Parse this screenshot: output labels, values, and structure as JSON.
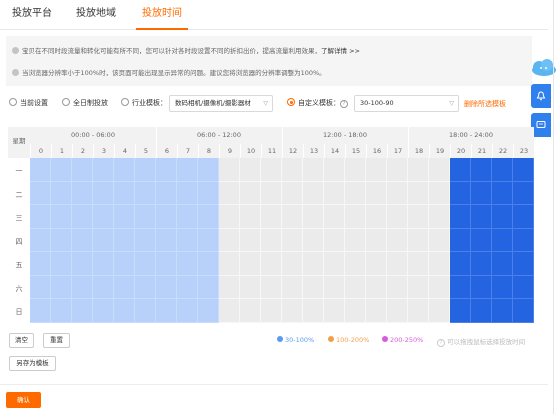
{
  "tabs": [
    {
      "label": "投放平台",
      "active": false
    },
    {
      "label": "投放地域",
      "active": false
    },
    {
      "label": "投放时间",
      "active": true
    }
  ],
  "notice": {
    "line1": "宝贝在不同时段流量和转化可能有所不同，您可以针对各时段设置不同的折扣出价，提高流量利用效果，",
    "line1_link": "了解详情 >>",
    "line2": "当浏览器分辨率小于100%时，该页面可能出现显示异常的问题。建议您将浏览器的分辨率调整为100%。"
  },
  "options": {
    "current": "当前设置",
    "all_day": "全日制投放",
    "industry_label": "行业模板：",
    "industry_select": "数码相机/摄像机/摄影器材",
    "custom_label": "自定义模板：",
    "custom_select": "30-100-90",
    "delete_link": "删除所选模板",
    "selected": "custom"
  },
  "grid": {
    "week_label": "星期",
    "periods": [
      "00:00 - 06:00",
      "06:00 - 12:00",
      "12:00 - 18:00",
      "18:00 - 24:00"
    ],
    "hours": [
      "0",
      "1",
      "2",
      "3",
      "4",
      "5",
      "6",
      "7",
      "8",
      "9",
      "10",
      "11",
      "12",
      "13",
      "14",
      "15",
      "16",
      "17",
      "18",
      "19",
      "20",
      "21",
      "22",
      "23"
    ],
    "days": [
      "一",
      "二",
      "三",
      "四",
      "五",
      "六",
      "日"
    ],
    "hour_levels": [
      "light",
      "light",
      "light",
      "light",
      "light",
      "light",
      "light",
      "light",
      "light",
      "none",
      "none",
      "none",
      "none",
      "none",
      "none",
      "none",
      "none",
      "none",
      "none",
      "none",
      "dark",
      "dark",
      "dark",
      "dark"
    ]
  },
  "buttons": {
    "clear": "清空",
    "reset": "重置",
    "save_template": "另存为模板",
    "confirm": "确认"
  },
  "legend": [
    {
      "label": "30-100%",
      "color": "#5b9bf0"
    },
    {
      "label": "100-200%",
      "color": "#f0a04b"
    },
    {
      "label": "200-250%",
      "color": "#d75cdc"
    }
  ],
  "legend_hint": "可以拖拽鼠标选择投放时间",
  "colors": {
    "accent": "#ff6a00",
    "light_blue": "#b7d1fb",
    "dark_blue": "#2464e0",
    "empty": "#ebebeb"
  }
}
